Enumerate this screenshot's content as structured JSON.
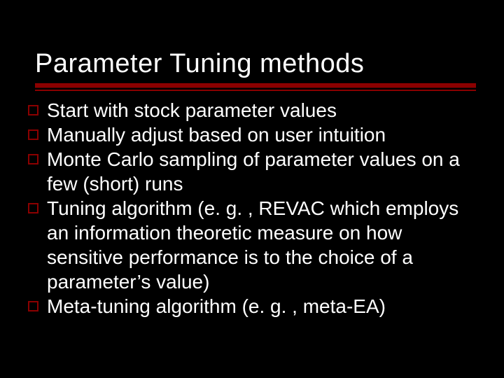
{
  "slide": {
    "title": "Parameter Tuning methods",
    "bullets": [
      "Start with stock parameter values",
      "Manually adjust based on user intuition",
      "Monte Carlo sampling of parameter values on a few (short) runs",
      "Tuning algorithm (e. g. , REVAC which employs an information theoretic measure on how sensitive performance is to the choice of a parameter’s value)",
      "Meta-tuning algorithm (e. g. , meta-EA)"
    ]
  }
}
